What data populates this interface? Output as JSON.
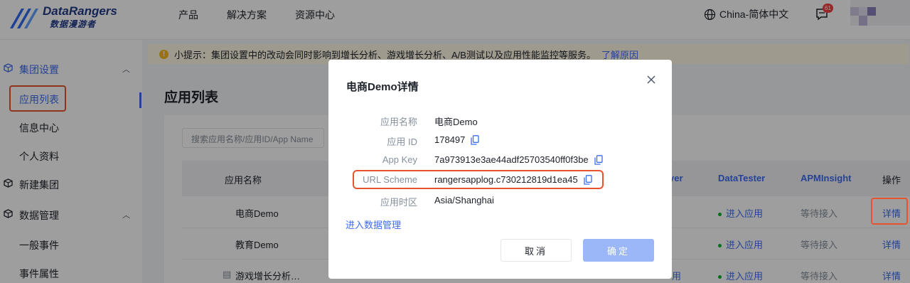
{
  "topbar": {
    "logo_title": "DataRangers",
    "logo_subtitle": "数据漫游者",
    "nav": [
      "产品",
      "解决方案",
      "资源中心"
    ],
    "language": "China-简体中文",
    "message_count": "61"
  },
  "sidebar": {
    "group1_label": "集团设置",
    "group1_items": [
      "应用列表",
      "信息中心",
      "个人资料"
    ],
    "group2_label": "新建集团",
    "group3_label": "数据管理",
    "group3_items": [
      "一般事件",
      "事件属性"
    ]
  },
  "notice": {
    "text": "小提示：集团设置中的改动会同时影响到增长分析、游戏增长分析、A/B测试以及应用性能监控等服务。",
    "link": "了解原因"
  },
  "page": {
    "title": "应用列表",
    "search_placeholder": "搜索应用名称/应用ID/App Name"
  },
  "table": {
    "columns": {
      "name": "应用名称",
      "player_partial": "yer",
      "datatester": "DataTester",
      "apminsight": "APMInsight",
      "action": "操作"
    },
    "rows": [
      {
        "name": "电商Demo",
        "datatester": "进入应用",
        "apminsight": "等待接入",
        "action": "详情"
      },
      {
        "name": "教育Demo",
        "datatester": "进入应用",
        "apminsight": "等待接入",
        "action": "详情"
      },
      {
        "name": "游戏增长分析…",
        "player_partial": "用",
        "datatester": "进入应用",
        "apminsight": "等待接入",
        "action": "详情"
      }
    ]
  },
  "modal": {
    "title": "电商Demo详情",
    "fields": [
      {
        "label": "应用名称",
        "value": "电商Demo"
      },
      {
        "label": "应用 ID",
        "value": "178497"
      },
      {
        "label": "App Key",
        "value": "7a973913e3ae44adf25703540ff0f3be"
      },
      {
        "label": "URL Scheme",
        "value": "rangersapplog.c730212819d1ea45"
      },
      {
        "label": "应用时区",
        "value": "Asia/Shanghai"
      }
    ],
    "data_link": "进入数据管理",
    "cancel_label": "取消",
    "ok_label": "确定"
  },
  "colors": {
    "accent": "#3d6bf0",
    "highlight": "#e8532f",
    "ok_disabled": "#9cb7f7"
  }
}
